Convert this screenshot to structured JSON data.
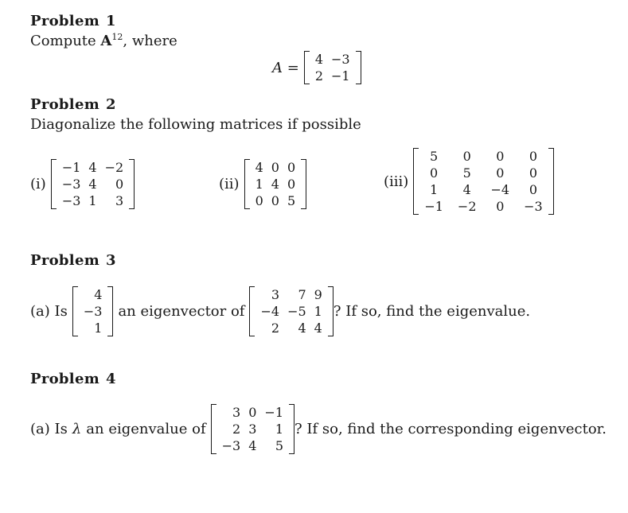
{
  "problems": [
    {
      "heading": "Problem",
      "number": "1",
      "prompt_prefix": "Compute ",
      "prompt_symbol": "A",
      "prompt_exponent": "12",
      "prompt_suffix": ", where",
      "matrix_label": "A =",
      "matrix": [
        [
          "4",
          "−3"
        ],
        [
          "2",
          "−1"
        ]
      ]
    },
    {
      "heading": "Problem",
      "number": "2",
      "prompt": "Diagonalize the following matrices if possible",
      "parts": [
        {
          "label": "(i)",
          "matrix": [
            [
              "−1",
              "4",
              "−2"
            ],
            [
              "−3",
              "4",
              "0"
            ],
            [
              "−3",
              "1",
              "3"
            ]
          ]
        },
        {
          "label": "(ii)",
          "matrix": [
            [
              "4",
              "0",
              "0"
            ],
            [
              "1",
              "4",
              "0"
            ],
            [
              "0",
              "0",
              "5"
            ]
          ]
        },
        {
          "label": "(iii)",
          "matrix": [
            [
              "5",
              "0",
              "0",
              "0"
            ],
            [
              "0",
              "5",
              "0",
              "0"
            ],
            [
              "1",
              "4",
              "−4",
              "0"
            ],
            [
              "−1",
              "−2",
              "0",
              "−3"
            ]
          ]
        }
      ]
    },
    {
      "heading": "Problem",
      "number": "3",
      "part_label": "(a) Is",
      "vector": [
        [
          "4"
        ],
        [
          "−3"
        ],
        [
          "1"
        ]
      ],
      "middle_text": "an eigenvector of",
      "matrix": [
        [
          "3",
          "7",
          "9"
        ],
        [
          "−4",
          "−5",
          "1"
        ],
        [
          "2",
          "4",
          "4"
        ]
      ],
      "suffix": "? If so, find the eigenvalue."
    },
    {
      "heading": "Problem",
      "number": "4",
      "part_label": "(a) Is",
      "lambda": "λ",
      "middle_text": "an eigenvalue of",
      "matrix": [
        [
          "3",
          "0",
          "−1"
        ],
        [
          "2",
          "3",
          "1"
        ],
        [
          "−3",
          "4",
          "5"
        ]
      ],
      "suffix": "? If so, find the corresponding eigenvector."
    }
  ]
}
